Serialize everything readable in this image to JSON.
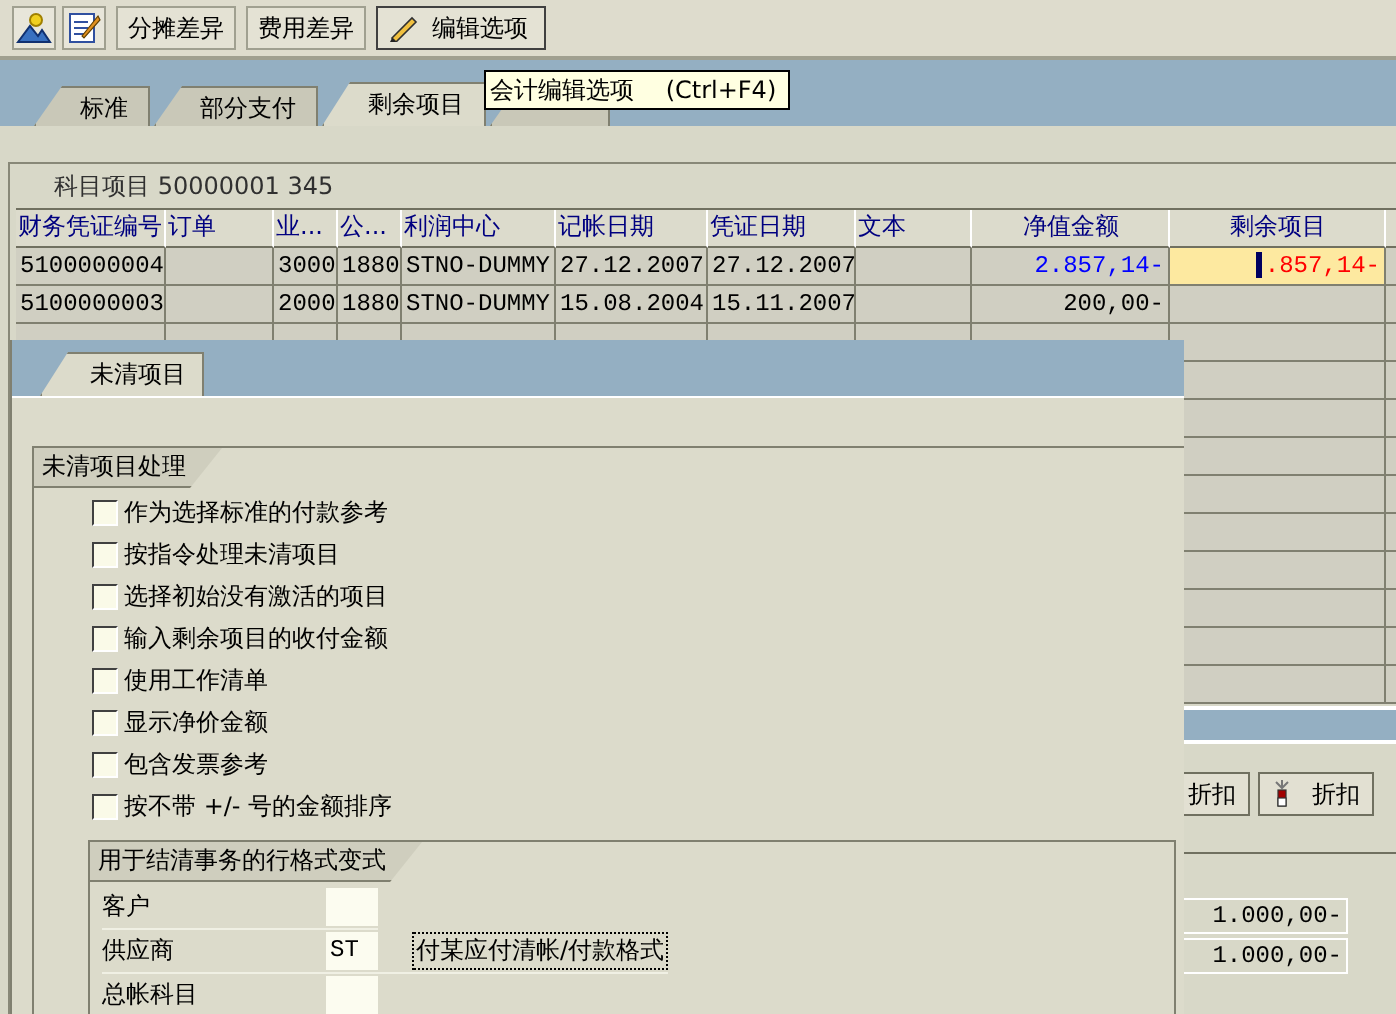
{
  "toolbar": {
    "buttons": [
      {
        "label": "分摊差异",
        "kind": "text"
      },
      {
        "label": "费用差异",
        "kind": "text"
      },
      {
        "label": "编辑选项",
        "kind": "pencil"
      }
    ]
  },
  "tooltip": "会计编辑选项　 (Ctrl+F4)",
  "tabs": [
    {
      "label": "标准",
      "selected": false
    },
    {
      "label": "部分支付",
      "selected": false
    },
    {
      "label": "剩余项目",
      "selected": true
    },
    {
      "selected": false
    }
  ],
  "account_item": "科目项目 50000001 345",
  "table": {
    "columns": [
      "财务凭证编号",
      "订单",
      "业...",
      "公...",
      "利润中心",
      "记帐日期",
      "凭证日期",
      "文本",
      "净值金额",
      "剩余项目"
    ],
    "rows": [
      {
        "selected": true,
        "cells": [
          "5100000004",
          "",
          "3000",
          "1880",
          "STNO-DUMMY",
          "27.12.2007",
          "27.12.2007",
          "",
          "2.857,14-"
        ],
        "remaining": ".857,14-"
      },
      {
        "selected": false,
        "cells": [
          "5100000003",
          "",
          "2000",
          "1880",
          "STNO-DUMMY",
          "15.08.2004",
          "15.11.2007",
          "",
          "200,00-"
        ]
      }
    ]
  },
  "bottom_buttons": [
    "折扣",
    "折扣"
  ],
  "totals": [
    "1.000,00-",
    "1.000,00-"
  ],
  "dialog": {
    "tab": "未清项目",
    "group_title": "未清项目处理",
    "options": [
      {
        "label": "作为选择标准的付款参考",
        "checked": false
      },
      {
        "label": "按指令处理未清项目",
        "checked": false
      },
      {
        "label": "选择初始没有激活的项目",
        "checked": false
      },
      {
        "label": "输入剩余项目的收付金额",
        "checked": false
      },
      {
        "label": "使用工作清单",
        "checked": false
      },
      {
        "label": "显示净价金额",
        "checked": false
      },
      {
        "label": "包含发票参考",
        "checked": false
      },
      {
        "label": "按不带 +/- 号的金额排序",
        "checked": false
      }
    ],
    "subgroup": {
      "title": "用于结清事务的行格式变式",
      "fields": [
        {
          "label": "客户"
        },
        {
          "label": "供应商",
          "value": "ST"
        },
        {
          "label": "总帐科目"
        }
      ],
      "link": "付某应付清帐/付款格式"
    }
  }
}
